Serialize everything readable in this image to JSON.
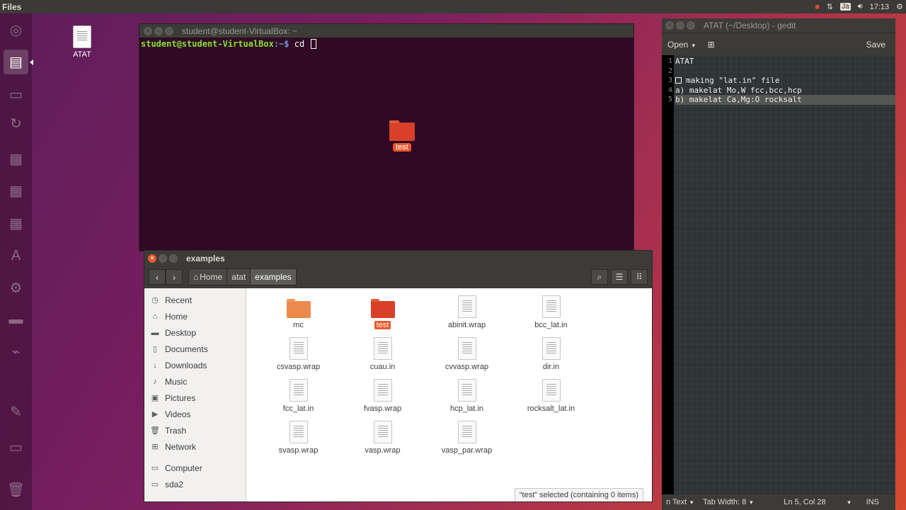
{
  "top_panel": {
    "app_name": "Files",
    "time": "17:13",
    "keyboard": "Ja"
  },
  "launcher": {
    "items": [
      "dash-icon",
      "files-icon",
      "terminal-icon",
      "update-icon",
      "writer-icon",
      "calc-icon",
      "impress-icon",
      "software-icon",
      "settings-icon",
      "drive-icon",
      "monitor-icon",
      "text-editor-icon",
      "disk-icon",
      "trash-icon"
    ]
  },
  "desktop": {
    "icon_label": "ATAT"
  },
  "terminal": {
    "title": "student@student-VirtualBox: ~",
    "prompt_user": "student@student-VirtualBox",
    "prompt_path": ":~$",
    "command": " cd "
  },
  "drag": {
    "label": "test"
  },
  "gedit": {
    "title": "ATAT (~/Desktop) - gedit",
    "open_label": "Open",
    "save_label": "Save",
    "line_numbers": [
      "1",
      "2",
      "3",
      "4",
      "5"
    ],
    "lines": [
      "ATAT",
      "",
      "making \"lat.in\" file",
      "a) makelat Mo,W fcc,bcc,hcp",
      "b) makelat Ca,Mg:O rocksalt"
    ],
    "status": {
      "lang": "n Text",
      "tab_width": "Tab Width: 8",
      "position": "Ln 5, Col 28",
      "mode": "INS"
    }
  },
  "files": {
    "title": "examples",
    "breadcrumbs": [
      "Home",
      "atat",
      "examples"
    ],
    "sidebar": [
      "Recent",
      "Home",
      "Desktop",
      "Documents",
      "Downloads",
      "Music",
      "Pictures",
      "Videos",
      "Trash",
      "Network",
      "Computer",
      "sda2"
    ],
    "items": [
      [
        "mc",
        "test",
        "abinit.wrap",
        "bcc_lat.in"
      ],
      [
        "csvasp.wrap",
        "cuau.in",
        "cvvasp.wrap",
        "dir.in"
      ],
      [
        "fcc_lat.in",
        "fvasp.wrap",
        "hcp_lat.in",
        "rocksalt_lat.in"
      ],
      [
        "svasp.wrap",
        "vasp.wrap",
        "vasp_par.wrap"
      ]
    ],
    "status": "“test” selected  (containing 0 items)"
  },
  "colors": {
    "accent": "#e8582d",
    "terminal_bg": "#300a24",
    "panel": "#3c3b37"
  }
}
